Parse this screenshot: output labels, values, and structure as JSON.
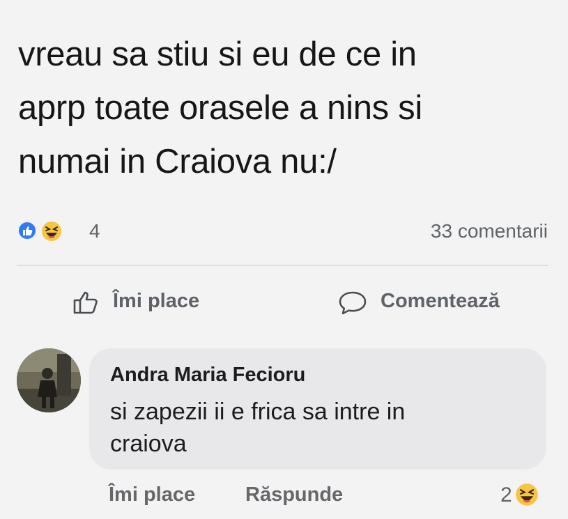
{
  "post": {
    "text_lines": [
      "vreau sa stiu si eu de ce in",
      "aprp toate orasele a nins si",
      "numai in Craiova nu:/"
    ]
  },
  "reactions": {
    "count": "4",
    "icons": [
      "like-icon",
      "haha-icon"
    ],
    "comments_count_label": "33 comentarii"
  },
  "actions": {
    "like_label": "Îmi place",
    "comment_label": "Comentează"
  },
  "comment": {
    "author": "Andra Maria Fecioru",
    "text_lines": [
      "si zapezii ii e frica sa intre in",
      "craiova"
    ],
    "like_label": "Îmi place",
    "reply_label": "Răspunde",
    "reaction_count": "2",
    "reaction_icon": "haha-icon"
  },
  "colors": {
    "like_blue": "#2d7cf4",
    "haha_yellow": "#f7c544",
    "bubble_bg": "#e8e8ea",
    "secondary_text": "#5f6368"
  }
}
